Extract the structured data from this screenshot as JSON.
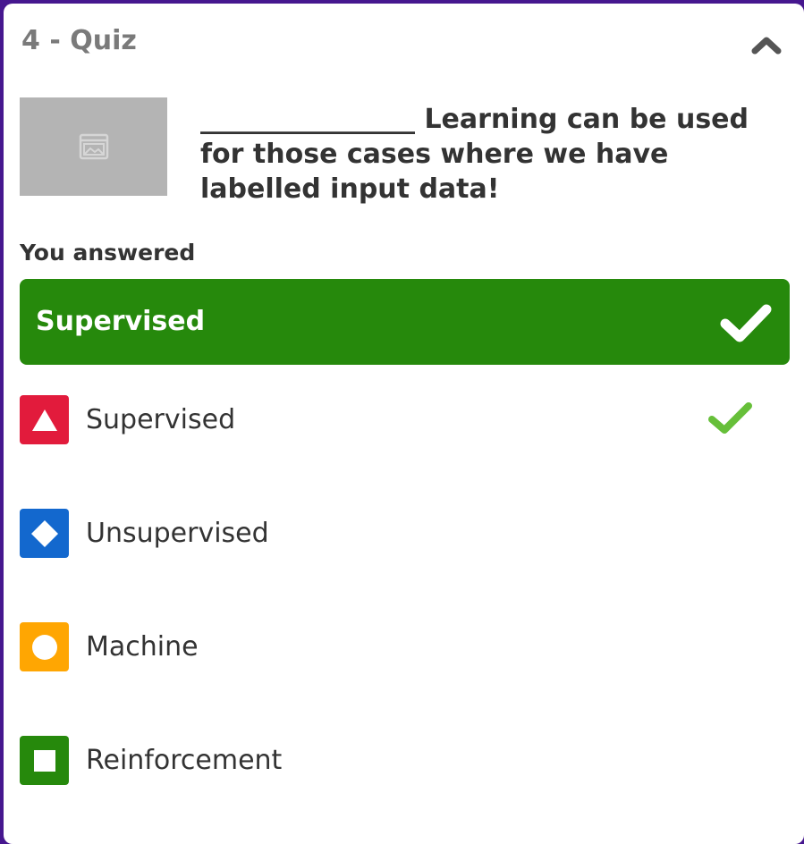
{
  "quiz": {
    "title": "4 - Quiz",
    "question": "________________ Learning can be used for those cases where we have labelled input data!",
    "answered_label": "You answered",
    "selected_answer": "Supervised"
  },
  "icons": {
    "collapse": "chevron-up-icon",
    "thumbnail": "image-placeholder-icon",
    "selected_check": "check-icon",
    "correct_check": "check-icon"
  },
  "colors": {
    "background": "#46178f",
    "banner": "#26890c",
    "thumbnail": "#b4b4b4",
    "correct_check": "#66bf39"
  },
  "options": [
    {
      "label": "Supervised",
      "shape": "triangle",
      "color": "#e21b3c",
      "correct": true
    },
    {
      "label": "Unsupervised",
      "shape": "diamond",
      "color": "#1368ce",
      "correct": false
    },
    {
      "label": "Machine",
      "shape": "circle",
      "color": "#ffa602",
      "correct": false
    },
    {
      "label": "Reinforcement",
      "shape": "square",
      "color": "#26890c",
      "correct": false
    }
  ]
}
